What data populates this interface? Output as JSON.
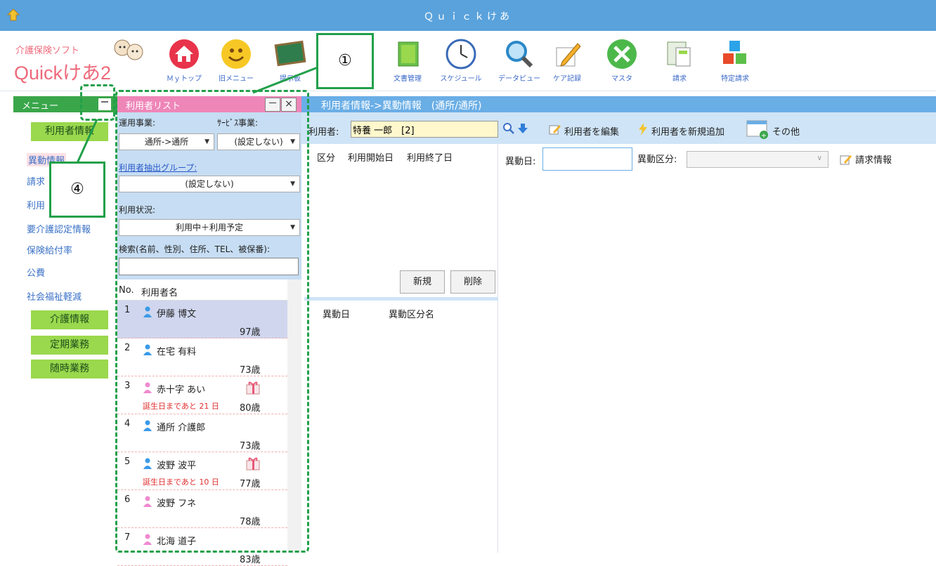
{
  "window": {
    "title": "Ｑｕｉｃｋけあ"
  },
  "logo": {
    "subtitle": "介護保険ソフト",
    "main": "Quickけあ2"
  },
  "ribbon": {
    "buttons": [
      {
        "label": "Ｍｙトップ",
        "icon": "home-icon"
      },
      {
        "label": "旧メニュー",
        "icon": "smiley-icon"
      },
      {
        "label": "提示板",
        "icon": "board-icon"
      },
      {
        "label": "文書管理",
        "icon": "folder-icon"
      },
      {
        "label": "スケジュール",
        "icon": "clock-icon"
      },
      {
        "label": "データビュー",
        "icon": "magnifier-icon"
      },
      {
        "label": "ケア記録",
        "icon": "pen-icon"
      },
      {
        "label": "マスタ",
        "icon": "tools-icon"
      },
      {
        "label": "請求",
        "icon": "calculator-icon"
      },
      {
        "label": "特定請求",
        "icon": "cubes-icon"
      }
    ]
  },
  "menu": {
    "header": "メニュー",
    "min_label": "－",
    "section_user": "利用者情報",
    "links": [
      "異動情報",
      "請求",
      "利用",
      "要介護認定情報",
      "保険給付率",
      "公費",
      "社会福祉軽減"
    ],
    "section_care": "介護情報",
    "section_periodic": "定期業務",
    "section_adhoc": "随時業務"
  },
  "user_list": {
    "header": "利用者リスト",
    "min_label": "－",
    "close_label": "×",
    "label_business": "運用事業:",
    "label_service": "ｻｰﾋﾞｽ事業:",
    "business_value": "通所->通所",
    "service_value": "(設定しない)",
    "label_group": "利用者抽出グループ:",
    "group_value": "(設定しない)",
    "label_status": "利用状況:",
    "status_value": "利用中＋利用予定",
    "label_search": "検索(名前、性別、住所、TEL、被保番):",
    "search_value": "",
    "col_no": "No.",
    "col_name": "利用者名",
    "rows": [
      {
        "no": "1",
        "name": "伊藤 博文",
        "age": "97歳",
        "gender": "male",
        "birthday": ""
      },
      {
        "no": "2",
        "name": "在宅 有料",
        "age": "73歳",
        "gender": "male",
        "birthday": ""
      },
      {
        "no": "3",
        "name": "赤十字 あい",
        "age": "80歳",
        "gender": "female",
        "birthday": "誕生日まであと 21 日"
      },
      {
        "no": "4",
        "name": "通所 介護郎",
        "age": "73歳",
        "gender": "male",
        "birthday": ""
      },
      {
        "no": "5",
        "name": "波野 波平",
        "age": "77歳",
        "gender": "male",
        "birthday": "誕生日まであと 10 日"
      },
      {
        "no": "6",
        "name": "波野 フネ",
        "age": "78歳",
        "gender": "female",
        "birthday": ""
      },
      {
        "no": "7",
        "name": "北海 道子",
        "age": "83歳",
        "gender": "female",
        "birthday": ""
      }
    ]
  },
  "main": {
    "header": "利用者情報->異動情報　(通所/通所)",
    "user_label": "利用者:",
    "user_value": "特養 一郎　[2]",
    "edit_user": "利用者を編集",
    "add_user": "利用者を新規追加",
    "other": "その他",
    "col_kubun": "区分",
    "col_start": "利用開始日",
    "col_end": "利用終了日",
    "btn_new": "新規",
    "btn_delete": "削除",
    "col_idou_date": "異動日",
    "col_idou_kubun": "異動区分名",
    "label_idou_date": "異動日:",
    "label_idou_kubun": "異動区分:",
    "billing_info": "請求情報"
  },
  "annotations": {
    "callout1": "①",
    "callout4": "④"
  },
  "colors": {
    "title_bar": "#5aa2dc",
    "menu_header": "#3aa64a",
    "list_header": "#ee86b8",
    "annotation": "#21a04a"
  }
}
